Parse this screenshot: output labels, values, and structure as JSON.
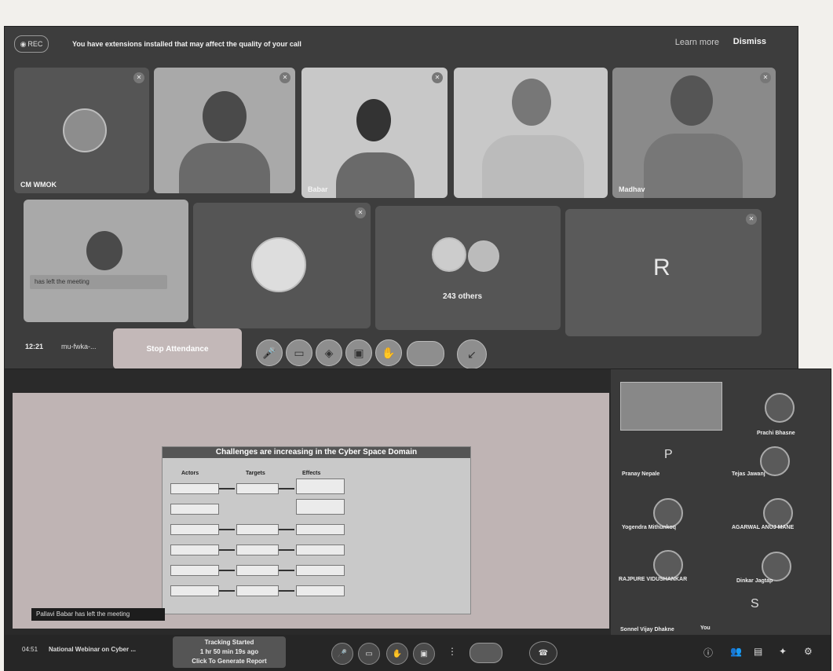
{
  "top_call": {
    "banner": {
      "rec_label": "REC",
      "message": "You have extensions installed that may affect the quality of your call",
      "learn_more": "Learn more",
      "dismiss": "Dismiss"
    },
    "tiles": [
      {
        "name": "CM WMOK"
      },
      {
        "name": ""
      },
      {
        "name": "Babar"
      },
      {
        "name": ""
      },
      {
        "name": "Madhav"
      },
      {
        "name": "",
        "left_message": "has left the meeting"
      },
      {
        "name": ""
      },
      {
        "name": "",
        "others": "243 others"
      },
      {
        "name": "",
        "initial": "R"
      }
    ],
    "control_bar": {
      "time": "12:21",
      "meeting_code": "mu-fwka-...",
      "stop_button": "Stop Attendance"
    }
  },
  "bottom_call": {
    "slide": {
      "title": "Challenges are increasing in the Cyber Space Domain",
      "col_actors": "Actors",
      "col_targets": "Targets",
      "col_effects": "Effects"
    },
    "participants": [
      {
        "name": "Prachi Bhasne"
      },
      {
        "name": "Pranay Nepale",
        "initial": "P"
      },
      {
        "name": "Tejas Jawanj"
      },
      {
        "name": "Yogendra Mithunkoq"
      },
      {
        "name": "AGARWAL ANUJ MANE"
      },
      {
        "name": "RAJPURE VIDUSHANKAR"
      },
      {
        "name": "Dinkar Jagtap"
      },
      {
        "name": "Sonnel Vijay Dhakne",
        "initial": "S"
      },
      {
        "name": "You"
      }
    ],
    "toast": "Pallavi Babar has left the meeting",
    "bottom_bar": {
      "time": "04:51",
      "meeting_title": "National Webinar on Cyber ...",
      "tracking_line1": "Tracking Started",
      "tracking_line2": "1 hr 50 min 19s ago",
      "tracking_line3": "Click To Generate Report"
    }
  }
}
